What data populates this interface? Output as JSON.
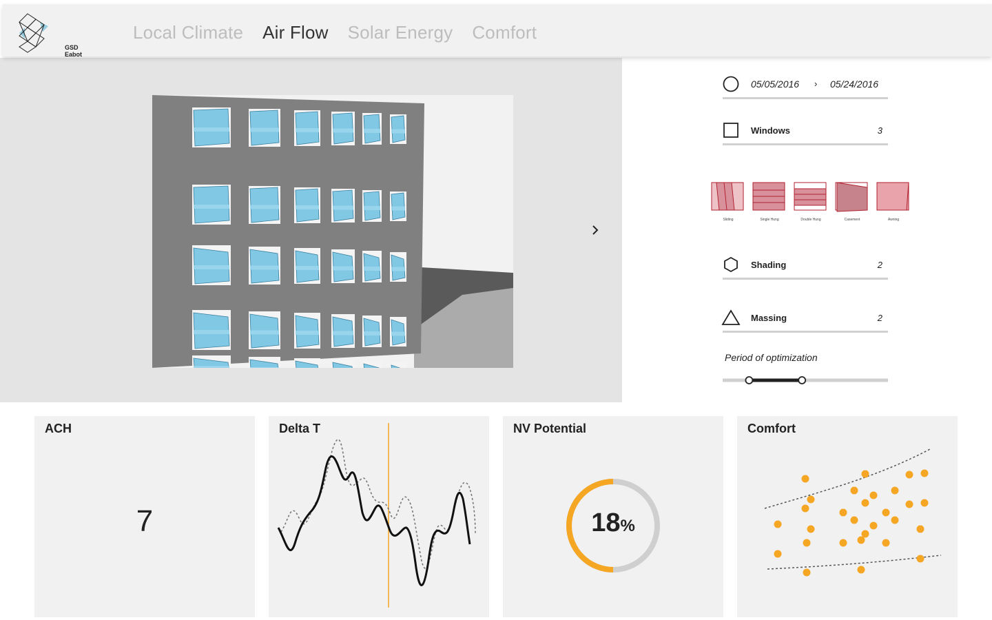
{
  "app": {
    "logo_text": "GSD Eabot"
  },
  "nav": {
    "tabs": [
      {
        "label": "Local Climate",
        "active": false
      },
      {
        "label": "Air Flow",
        "active": true
      },
      {
        "label": "Solar Energy",
        "active": false
      },
      {
        "label": "Comfort",
        "active": false
      }
    ]
  },
  "panel": {
    "date_start": "05/05/2016",
    "date_end": "05/24/2016",
    "windows": {
      "label": "Windows",
      "value": "3"
    },
    "window_types": [
      "Sliding",
      "Single Hung",
      "Double Hung",
      "Casement",
      "Awning"
    ],
    "shading": {
      "label": "Shading",
      "value": "2"
    },
    "massing": {
      "label": "Massing",
      "value": "2"
    },
    "period_label": "Period of optimization",
    "period_range": [
      0.16,
      0.48
    ]
  },
  "cards": {
    "ach": {
      "title": "ACH",
      "value": "7"
    },
    "delta_t": {
      "title": "Delta T"
    },
    "nv": {
      "title": "NV Potential",
      "value": "18",
      "unit": "%",
      "fraction": 0.18
    },
    "comfort": {
      "title": "Comfort"
    }
  },
  "colors": {
    "accent": "#f5a623",
    "tab_inactive": "#bdbdbd",
    "window_glass": "#6cc0e0",
    "window_type_fill": "#d8919a",
    "window_type_stroke": "#b22030"
  }
}
